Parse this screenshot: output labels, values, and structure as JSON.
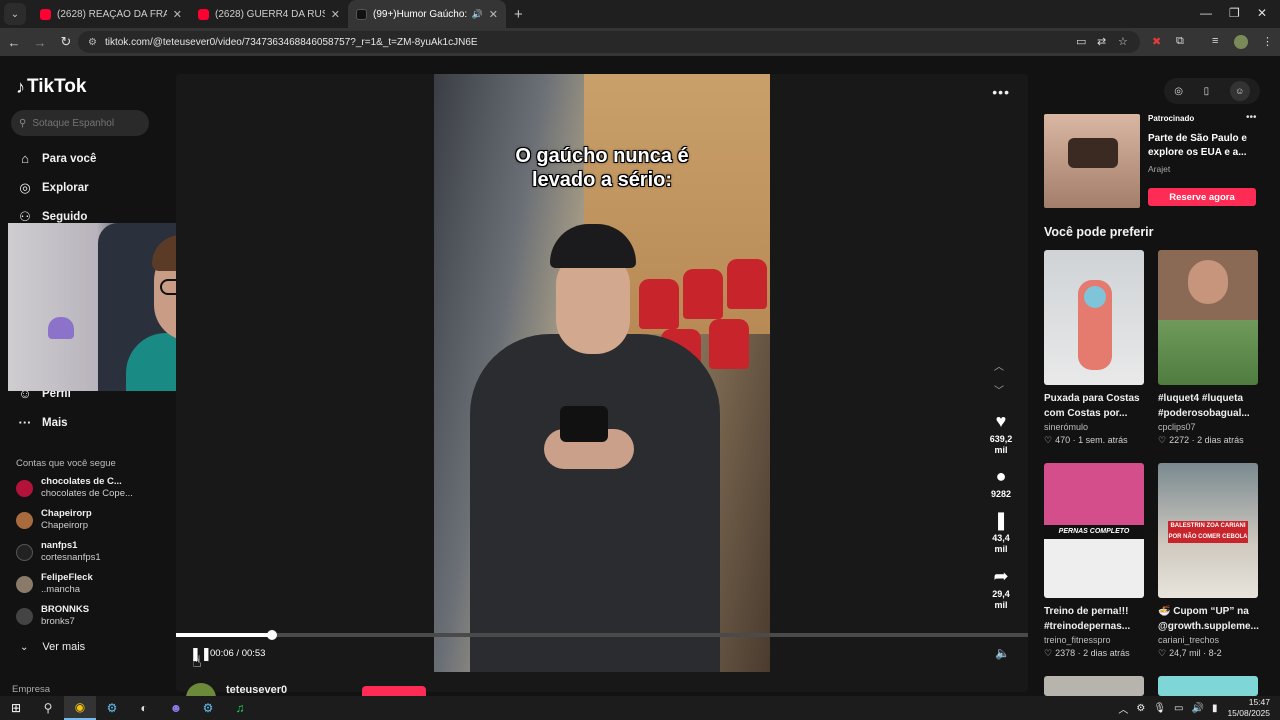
{
  "browser": {
    "tabs": [
      {
        "label": "(2628) REAÇÃO DA FRANÇA CO",
        "favicon_color": "#ff0033"
      },
      {
        "label": "(2628) GUERR4 DA RUSS1A X K",
        "favicon_color": "#ff0033"
      },
      {
        "label": "(99+)Humor Gaúcho: Palav",
        "favicon_color": "#111111",
        "active": true
      }
    ],
    "url": "tiktok.com/@teteusever0/video/7347363468846058757?_r=1&_t=ZM-8yuAk1cJN6E"
  },
  "sidebar": {
    "logo": "TikTok",
    "search_placeholder": "Sotaque Espanhol",
    "nav": [
      {
        "label": "Para você",
        "icon": "home-icon"
      },
      {
        "label": "Explorar",
        "icon": "compass-icon"
      },
      {
        "label": "Seguido",
        "icon": "following-icon"
      },
      {
        "label": "Perfil",
        "icon": "profile-icon"
      },
      {
        "label": "Mais",
        "icon": "more-icon"
      }
    ],
    "following_heading": "Contas que você segue",
    "following": [
      {
        "name": "chocolates de C...",
        "sub": "chocolates de Cope...",
        "color": "#b3123a"
      },
      {
        "name": "Chapeirorp",
        "sub": "Chapeirorp",
        "color": "#a86b3d"
      },
      {
        "name": "nanfps1",
        "sub": "cortesnanfps1",
        "color": "#222222"
      },
      {
        "name": "FelipeFleck",
        "sub": "..mancha",
        "color": "#8a7a6a"
      },
      {
        "name": "BRONNKS",
        "sub": "bronks7",
        "color": "#444444"
      }
    ],
    "see_more": "Ver mais",
    "footer": "Empresa"
  },
  "video": {
    "caption": "O gaúcho nunca é\nlevado a sério:",
    "likes": "639,2\nmil",
    "comments": "9282",
    "saves": "43,4\nmil",
    "shares": "29,4\nmil",
    "time": "00:06 / 00:53",
    "progress": 0.113
  },
  "author": {
    "username": "teteusever0"
  },
  "right": {
    "ad": {
      "sponsored": "Patrocinado",
      "title": "Parte de São Paulo e explore os EUA e a...",
      "brand": "Arajet",
      "cta": "Reserve agora"
    },
    "prefer_title": "Você pode preferir",
    "cards": [
      {
        "title": "Puxada para Costas com Costas por...",
        "user": "sinerómulo",
        "likes": "470",
        "age": "1 sem. atrás"
      },
      {
        "title": "#luquet4 #luqueta #poderosobagual...",
        "user": "cpclips07",
        "likes": "2272",
        "age": "2 dias atrás"
      },
      {
        "title": "Treino de perna!!! #treinodepernas...",
        "user": "treino_fitnesspro",
        "likes": "2378",
        "age": "2 dias atrás",
        "banner": "PERNAS COMPLETO"
      },
      {
        "title": "🍜 Cupom “UP” na @growth.suppleme...",
        "user": "cariani_trechos",
        "likes": "24,7 mil",
        "age": "8-2",
        "banner": "BALESTRIN ZOA CARIANI POR NÃO COMER CEBOLA"
      }
    ]
  },
  "taskbar": {
    "time": "15:47",
    "date": "15/08/2025"
  }
}
